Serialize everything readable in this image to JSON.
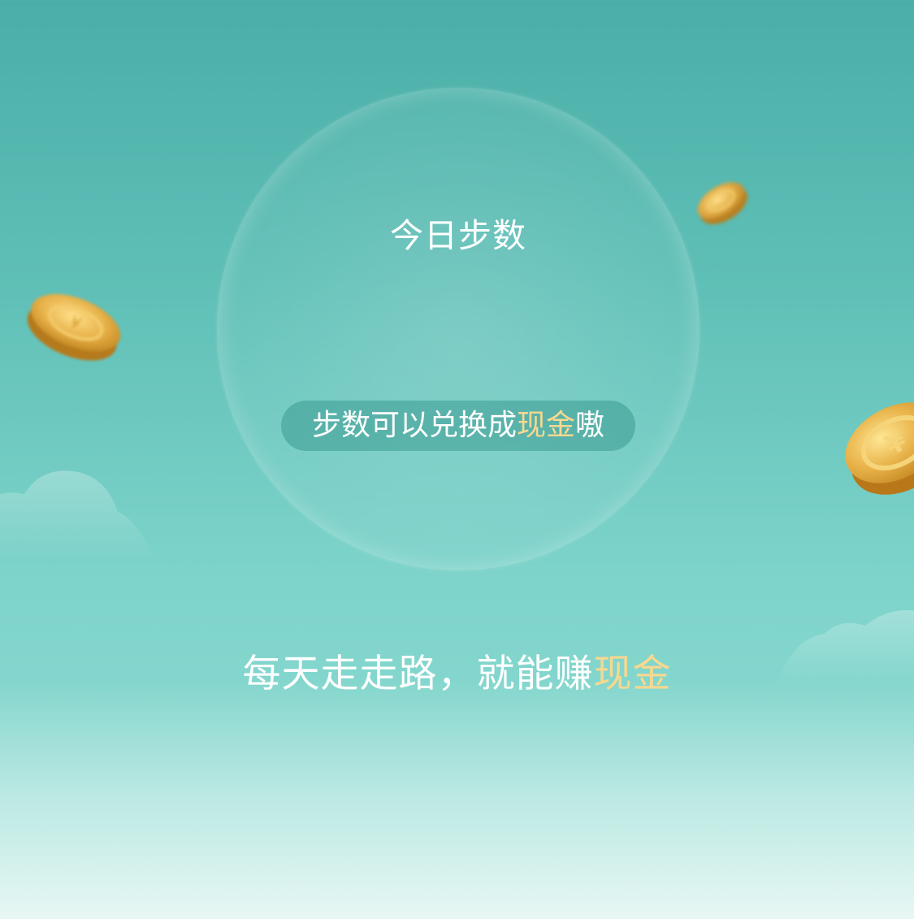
{
  "bubble": {
    "title": "今日步数",
    "pill_text": "步数可以兑换成",
    "pill_highlight": "现金",
    "pill_suffix": "嗷"
  },
  "slogan": {
    "text": "每天走走路，就能赚",
    "highlight": "现金"
  },
  "decorations": {
    "coins": [
      "coin-icon",
      "coin-icon",
      "coin-icon"
    ],
    "clouds": [
      "cloud-icon",
      "cloud-icon"
    ]
  },
  "colors": {
    "background_top": "#4aafa8",
    "background_bottom": "#e7f7f4",
    "highlight_gold": "#f7d88f",
    "text": "#ffffff"
  }
}
